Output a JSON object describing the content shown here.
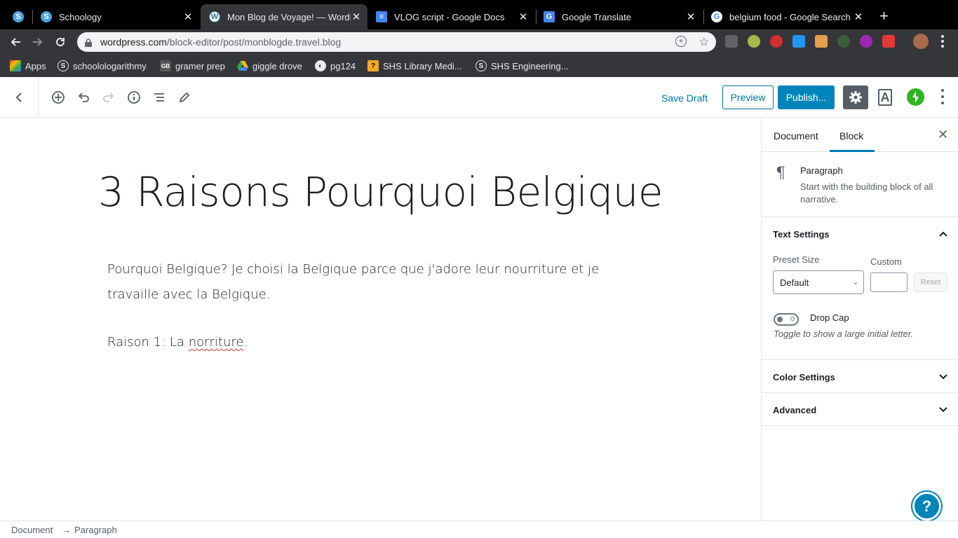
{
  "browser": {
    "tabs": [
      {
        "title": "Schoology",
        "active": false
      },
      {
        "title": "Mon Blog de Voyage! — WordP",
        "active": true
      },
      {
        "title": "VLOG script - Google Docs",
        "active": false
      },
      {
        "title": "Google Translate",
        "active": false
      },
      {
        "title": "belgium food - Google Search",
        "active": false
      }
    ],
    "url_host": "wordpress.com",
    "url_path": "/block-editor/post/monblogde.travel.blog",
    "bookmarks": [
      "Apps",
      "schoolologarithmy",
      "gramer prep",
      "giggle drove",
      "pg124",
      "SHS Library Medi...",
      "SHS Engineering..."
    ]
  },
  "editor_header": {
    "save_draft": "Save Draft",
    "preview": "Preview",
    "publish": "Publish..."
  },
  "post": {
    "title": "3 Raisons Pourquoi Belgique",
    "paragraph1": "Pourquoi Belgique? Je choisi la Belgique parce que j'adore leur nourriture et je travaille avec la Belgique.",
    "paragraph2_prefix": "Raison 1: La ",
    "paragraph2_misspelled": "norriture",
    "paragraph2_suffix": "."
  },
  "sidebar": {
    "tabs": [
      "Document",
      "Block"
    ],
    "active_tab": "Block",
    "block_name": "Paragraph",
    "block_description": "Start with the building block of all narrative.",
    "text_settings": {
      "title": "Text Settings",
      "preset_label": "Preset Size",
      "preset_value": "Default",
      "custom_label": "Custom",
      "reset": "Reset",
      "drop_cap_label": "Drop Cap",
      "drop_cap_help": "Toggle to show a large initial letter."
    },
    "color_settings": "Color Settings",
    "advanced": "Advanced"
  },
  "breadcrumb": {
    "root": "Document",
    "arrow": "→",
    "current": "Paragraph"
  },
  "colors": {
    "accent": "#0085ba",
    "link": "#0073aa",
    "jetpack": "#2fb41f"
  }
}
